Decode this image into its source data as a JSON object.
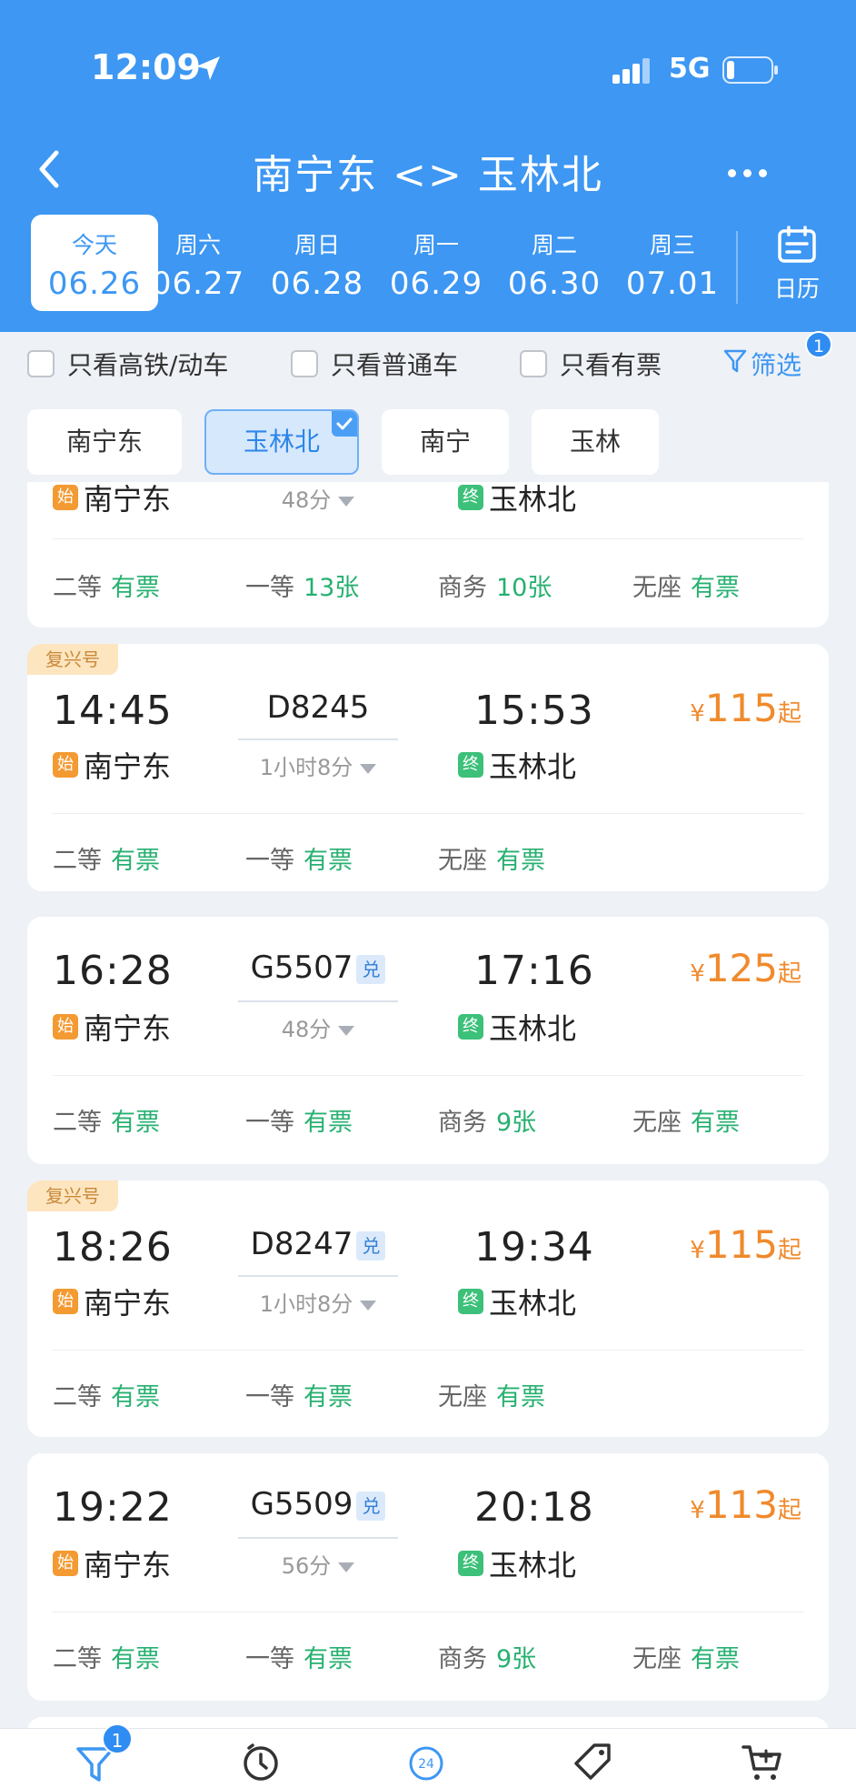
{
  "status_bar": {
    "time": "12:09",
    "network": "5G"
  },
  "nav": {
    "title": "南宁东 <> 玉林北"
  },
  "dates": [
    {
      "weekday": "今天",
      "date": "06.26",
      "active": true
    },
    {
      "weekday": "周六",
      "date": "06.27"
    },
    {
      "weekday": "周日",
      "date": "06.28"
    },
    {
      "weekday": "周一",
      "date": "06.29"
    },
    {
      "weekday": "周二",
      "date": "06.30"
    },
    {
      "weekday": "周三",
      "date": "07.01"
    }
  ],
  "calendar_label": "日历",
  "filters": {
    "high_speed": "只看高铁/动车",
    "normal": "只看普通车",
    "available": "只看有票",
    "screen": "筛选",
    "screen_badge": "1"
  },
  "stations": [
    "南宁东",
    "玉林北",
    "南宁",
    "玉林"
  ],
  "station_markers": {
    "start": "始",
    "end": "终"
  },
  "partial_card": {
    "from": "南宁东",
    "to": "玉林北",
    "duration": "48分",
    "seats": [
      {
        "label": "二等",
        "value": "有票"
      },
      {
        "label": "一等",
        "value": "13张"
      },
      {
        "label": "商务",
        "value": "10张"
      },
      {
        "label": "无座",
        "value": "有票"
      }
    ]
  },
  "trains": [
    {
      "tag": "复兴号",
      "dep": "14:45",
      "arr": "15:53",
      "no": "D8245",
      "dui": "",
      "duration": "1小时8分",
      "from": "南宁东",
      "to": "玉林北",
      "price_yen": "¥",
      "price": "115",
      "price_suffix": "起",
      "seats": [
        {
          "label": "二等",
          "value": "有票"
        },
        {
          "label": "一等",
          "value": "有票"
        },
        {
          "label": "无座",
          "value": "有票"
        }
      ]
    },
    {
      "tag": "",
      "dep": "16:28",
      "arr": "17:16",
      "no": "G5507",
      "dui": "兑",
      "duration": "48分",
      "from": "南宁东",
      "to": "玉林北",
      "price_yen": "¥",
      "price": "125",
      "price_suffix": "起",
      "seats": [
        {
          "label": "二等",
          "value": "有票"
        },
        {
          "label": "一等",
          "value": "有票"
        },
        {
          "label": "商务",
          "value": "9张"
        },
        {
          "label": "无座",
          "value": "有票"
        }
      ]
    },
    {
      "tag": "复兴号",
      "dep": "18:26",
      "arr": "19:34",
      "no": "D8247",
      "dui": "兑",
      "duration": "1小时8分",
      "from": "南宁东",
      "to": "玉林北",
      "price_yen": "¥",
      "price": "115",
      "price_suffix": "起",
      "seats": [
        {
          "label": "二等",
          "value": "有票"
        },
        {
          "label": "一等",
          "value": "有票"
        },
        {
          "label": "无座",
          "value": "有票"
        }
      ]
    },
    {
      "tag": "",
      "dep": "19:22",
      "arr": "20:18",
      "no": "G5509",
      "dui": "兑",
      "duration": "56分",
      "from": "南宁东",
      "to": "玉林北",
      "price_yen": "¥",
      "price": "113",
      "price_suffix": "起",
      "seats": [
        {
          "label": "二等",
          "value": "有票"
        },
        {
          "label": "一等",
          "value": "有票"
        },
        {
          "label": "商务",
          "value": "9张"
        },
        {
          "label": "无座",
          "value": "有票"
        }
      ]
    }
  ],
  "tabbar": {
    "badge": "1",
    "icons": [
      "filter-icon",
      "clock-icon",
      "24h-icon",
      "tag-icon",
      "cart-icon"
    ],
    "clock_24_text": "24"
  },
  "colors": {
    "primary": "#3d97f3",
    "price": "#f08a2c",
    "available": "#27b070"
  }
}
